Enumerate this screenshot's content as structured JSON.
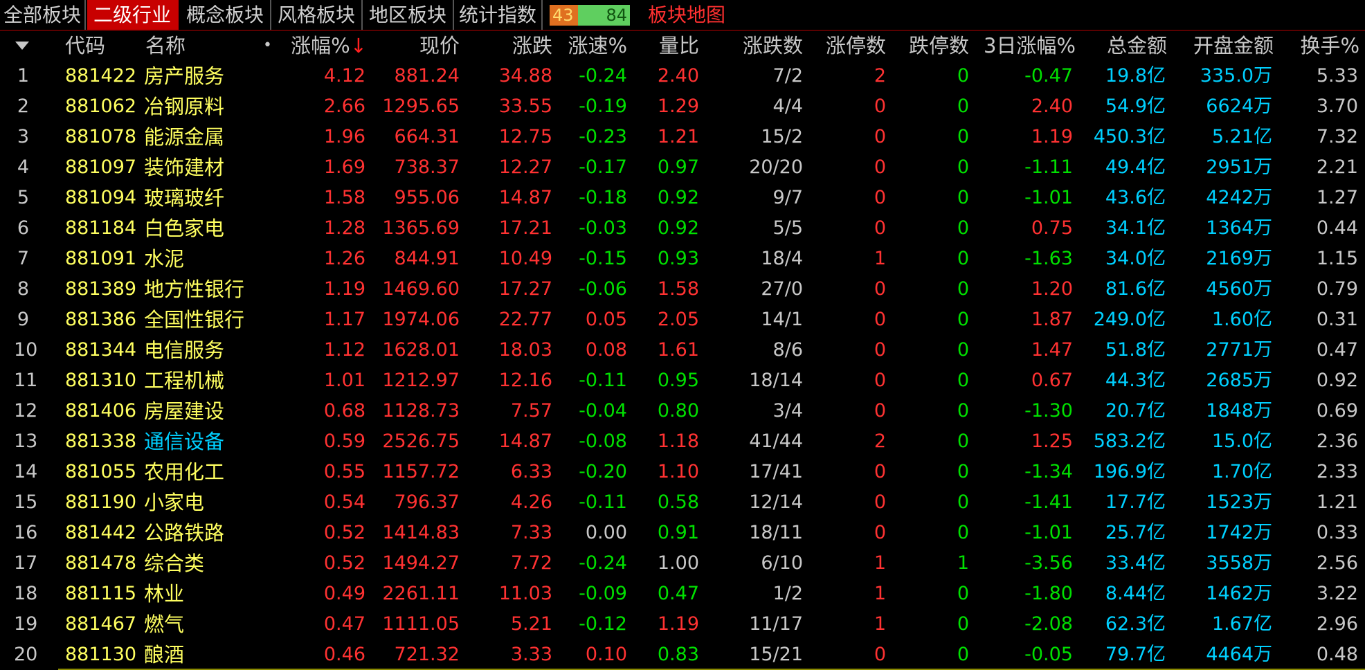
{
  "tabs": [
    {
      "label": "全部板块",
      "active": false
    },
    {
      "label": "二级行业",
      "active": true
    },
    {
      "label": "概念板块",
      "active": false
    },
    {
      "label": "风格板块",
      "active": false
    },
    {
      "label": "地区板块",
      "active": false
    },
    {
      "label": "统计指数",
      "active": false
    }
  ],
  "ratio": {
    "up": "43",
    "down": "84"
  },
  "map_link": "板块地图",
  "columns": {
    "code": "代码",
    "name": "名称",
    "pct": "涨幅%",
    "price": "现价",
    "change": "涨跌",
    "speed": "涨速%",
    "vol_ratio": "量比",
    "updown": "涨跌数",
    "limit_up": "涨停数",
    "limit_down": "跌停数",
    "pct3d": "3日涨幅%",
    "amount": "总金额",
    "open_amount": "开盘金额",
    "turnover": "换手%"
  },
  "sort_marker": "↓",
  "rows": [
    {
      "idx": "1",
      "code": "881422",
      "name": "房产服务",
      "pct": "4.12",
      "price": "881.24",
      "change": "34.88",
      "speed": "-0.24",
      "vol_ratio": "2.40",
      "updown": "7/2",
      "limit_up": "2",
      "limit_down": "0",
      "pct3d": "-0.47",
      "amount": "19.8亿",
      "open_amount": "335.0万",
      "turnover": "5.33"
    },
    {
      "idx": "2",
      "code": "881062",
      "name": "冶钢原料",
      "pct": "2.66",
      "price": "1295.65",
      "change": "33.55",
      "speed": "-0.19",
      "vol_ratio": "1.29",
      "updown": "4/4",
      "limit_up": "0",
      "limit_down": "0",
      "pct3d": "2.40",
      "amount": "54.9亿",
      "open_amount": "6624万",
      "turnover": "3.70"
    },
    {
      "idx": "3",
      "code": "881078",
      "name": "能源金属",
      "pct": "1.96",
      "price": "664.31",
      "change": "12.75",
      "speed": "-0.23",
      "vol_ratio": "1.21",
      "updown": "15/2",
      "limit_up": "0",
      "limit_down": "0",
      "pct3d": "1.19",
      "amount": "450.3亿",
      "open_amount": "5.21亿",
      "turnover": "7.32"
    },
    {
      "idx": "4",
      "code": "881097",
      "name": "装饰建材",
      "pct": "1.69",
      "price": "738.37",
      "change": "12.27",
      "speed": "-0.17",
      "vol_ratio": "0.97",
      "updown": "20/20",
      "limit_up": "0",
      "limit_down": "0",
      "pct3d": "-1.11",
      "amount": "49.4亿",
      "open_amount": "2951万",
      "turnover": "2.21"
    },
    {
      "idx": "5",
      "code": "881094",
      "name": "玻璃玻纤",
      "pct": "1.58",
      "price": "955.06",
      "change": "14.87",
      "speed": "-0.18",
      "vol_ratio": "0.92",
      "updown": "9/7",
      "limit_up": "0",
      "limit_down": "0",
      "pct3d": "-1.01",
      "amount": "43.6亿",
      "open_amount": "4242万",
      "turnover": "1.27"
    },
    {
      "idx": "6",
      "code": "881184",
      "name": "白色家电",
      "pct": "1.28",
      "price": "1365.69",
      "change": "17.21",
      "speed": "-0.03",
      "vol_ratio": "0.92",
      "updown": "5/5",
      "limit_up": "0",
      "limit_down": "0",
      "pct3d": "0.75",
      "amount": "34.1亿",
      "open_amount": "1364万",
      "turnover": "0.44"
    },
    {
      "idx": "7",
      "code": "881091",
      "name": "水泥",
      "pct": "1.26",
      "price": "844.91",
      "change": "10.49",
      "speed": "-0.15",
      "vol_ratio": "0.93",
      "updown": "18/4",
      "limit_up": "1",
      "limit_down": "0",
      "pct3d": "-1.63",
      "amount": "34.0亿",
      "open_amount": "2169万",
      "turnover": "1.15"
    },
    {
      "idx": "8",
      "code": "881389",
      "name": "地方性银行",
      "pct": "1.19",
      "price": "1469.60",
      "change": "17.27",
      "speed": "-0.06",
      "vol_ratio": "1.58",
      "updown": "27/0",
      "limit_up": "0",
      "limit_down": "0",
      "pct3d": "1.20",
      "amount": "81.6亿",
      "open_amount": "4560万",
      "turnover": "0.79"
    },
    {
      "idx": "9",
      "code": "881386",
      "name": "全国性银行",
      "pct": "1.17",
      "price": "1974.06",
      "change": "22.77",
      "speed": "0.05",
      "vol_ratio": "2.05",
      "updown": "14/1",
      "limit_up": "0",
      "limit_down": "0",
      "pct3d": "1.87",
      "amount": "249.0亿",
      "open_amount": "1.60亿",
      "turnover": "0.31"
    },
    {
      "idx": "10",
      "code": "881344",
      "name": "电信服务",
      "pct": "1.12",
      "price": "1628.01",
      "change": "18.03",
      "speed": "0.08",
      "vol_ratio": "1.61",
      "updown": "8/6",
      "limit_up": "0",
      "limit_down": "0",
      "pct3d": "1.47",
      "amount": "51.8亿",
      "open_amount": "2771万",
      "turnover": "0.47"
    },
    {
      "idx": "11",
      "code": "881310",
      "name": "工程机械",
      "pct": "1.01",
      "price": "1212.97",
      "change": "12.16",
      "speed": "-0.11",
      "vol_ratio": "0.95",
      "updown": "18/14",
      "limit_up": "0",
      "limit_down": "0",
      "pct3d": "0.67",
      "amount": "44.3亿",
      "open_amount": "2685万",
      "turnover": "0.92"
    },
    {
      "idx": "12",
      "code": "881406",
      "name": "房屋建设",
      "pct": "0.68",
      "price": "1128.73",
      "change": "7.57",
      "speed": "-0.04",
      "vol_ratio": "0.80",
      "updown": "3/4",
      "limit_up": "0",
      "limit_down": "0",
      "pct3d": "-1.30",
      "amount": "20.7亿",
      "open_amount": "1848万",
      "turnover": "0.69"
    },
    {
      "idx": "13",
      "code": "881338",
      "name": "通信设备",
      "name_cyan": true,
      "pct": "0.59",
      "price": "2526.75",
      "change": "14.87",
      "speed": "-0.08",
      "vol_ratio": "1.18",
      "updown": "41/44",
      "limit_up": "2",
      "limit_down": "0",
      "pct3d": "1.25",
      "amount": "583.2亿",
      "open_amount": "15.0亿",
      "turnover": "2.36"
    },
    {
      "idx": "14",
      "code": "881055",
      "name": "农用化工",
      "pct": "0.55",
      "price": "1157.72",
      "change": "6.33",
      "speed": "-0.20",
      "vol_ratio": "1.10",
      "updown": "17/41",
      "limit_up": "0",
      "limit_down": "0",
      "pct3d": "-1.34",
      "amount": "196.9亿",
      "open_amount": "1.70亿",
      "turnover": "2.33"
    },
    {
      "idx": "15",
      "code": "881190",
      "name": "小家电",
      "pct": "0.54",
      "price": "796.37",
      "change": "4.26",
      "speed": "-0.11",
      "vol_ratio": "0.58",
      "updown": "12/14",
      "limit_up": "0",
      "limit_down": "0",
      "pct3d": "-1.41",
      "amount": "17.7亿",
      "open_amount": "1523万",
      "turnover": "1.21"
    },
    {
      "idx": "16",
      "code": "881442",
      "name": "公路铁路",
      "pct": "0.52",
      "price": "1414.83",
      "change": "7.33",
      "speed": "0.00",
      "vol_ratio": "0.91",
      "updown": "18/11",
      "limit_up": "0",
      "limit_down": "0",
      "pct3d": "-1.01",
      "amount": "25.7亿",
      "open_amount": "1742万",
      "turnover": "0.33"
    },
    {
      "idx": "17",
      "code": "881478",
      "name": "综合类",
      "pct": "0.52",
      "price": "1494.27",
      "change": "7.72",
      "speed": "-0.24",
      "vol_ratio": "1.00",
      "updown": "6/10",
      "limit_up": "1",
      "limit_down": "1",
      "pct3d": "-3.56",
      "amount": "33.4亿",
      "open_amount": "3558万",
      "turnover": "2.56"
    },
    {
      "idx": "18",
      "code": "881115",
      "name": "林业",
      "pct": "0.49",
      "price": "2261.11",
      "change": "11.03",
      "speed": "-0.09",
      "vol_ratio": "0.47",
      "updown": "1/2",
      "limit_up": "1",
      "limit_down": "0",
      "pct3d": "-1.80",
      "amount": "8.44亿",
      "open_amount": "1462万",
      "turnover": "3.22"
    },
    {
      "idx": "19",
      "code": "881467",
      "name": "燃气",
      "pct": "0.47",
      "price": "1111.05",
      "change": "5.21",
      "speed": "-0.12",
      "vol_ratio": "1.19",
      "updown": "11/17",
      "limit_up": "1",
      "limit_down": "0",
      "pct3d": "-2.08",
      "amount": "62.3亿",
      "open_amount": "1.67亿",
      "turnover": "2.96"
    },
    {
      "idx": "20",
      "code": "881130",
      "name": "酿酒",
      "pct": "0.46",
      "price": "721.32",
      "change": "3.33",
      "speed": "0.10",
      "vol_ratio": "0.83",
      "updown": "15/21",
      "limit_up": "0",
      "limit_down": "0",
      "pct3d": "-0.05",
      "amount": "79.7亿",
      "open_amount": "4464万",
      "turnover": "0.48"
    }
  ],
  "colors": {
    "up": "#ff3232",
    "down": "#00e000",
    "flat": "#c8c8c8",
    "code": "#ffff60",
    "amount": "#00d0ff",
    "active_tab": "#c80000"
  }
}
